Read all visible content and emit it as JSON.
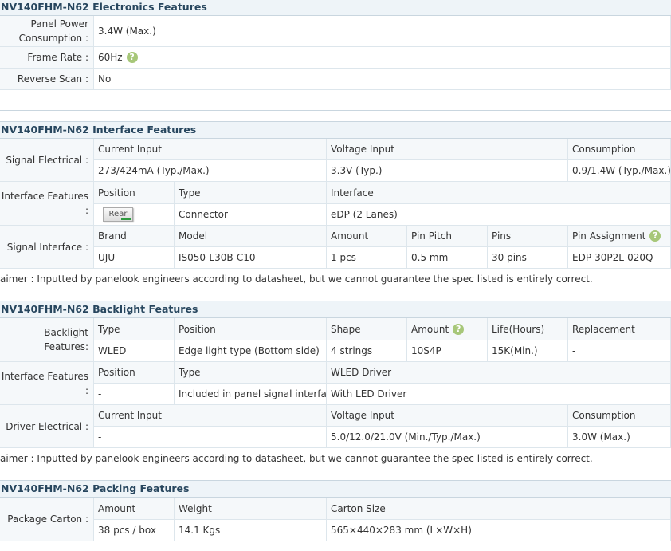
{
  "electronics": {
    "title": "NV140FHM-N62 Electronics Features",
    "rows": [
      {
        "label": "Panel Power Consumption :",
        "value": "3.4W (Max.)"
      },
      {
        "label": "Frame Rate :",
        "value": "60Hz"
      },
      {
        "label": "Reverse Scan :",
        "value": "No"
      }
    ]
  },
  "interface": {
    "title": "NV140FHM-N62 Interface Features",
    "signal_electrical": {
      "label": "Signal Electrical :",
      "headers": [
        "Current Input",
        "Voltage Input",
        "Consumption"
      ],
      "values": [
        "273/424mA (Typ./Max.)",
        "3.3V (Typ.)",
        "0.9/1.4W (Typ./Max.)"
      ]
    },
    "interface_features": {
      "label": "Interface Features :",
      "headers": [
        "Position",
        "Type",
        "Interface"
      ],
      "rear_button": "Rear",
      "values": [
        "Connector",
        "eDP (2 Lanes)"
      ]
    },
    "signal_interface": {
      "label": "Signal Interface :",
      "headers": [
        "Brand",
        "Model",
        "Amount",
        "Pin Pitch",
        "Pins",
        "Pin Assignment"
      ],
      "values": [
        "UJU",
        "IS050-L30B-C10",
        "1 pcs",
        "0.5 mm",
        "30 pins",
        "EDP-30P2L-020Q"
      ]
    },
    "disclaimer": "aimer : Inputted by panelook engineers according to datasheet, but we cannot guarantee the spec listed is entirely correct."
  },
  "backlight": {
    "title": "NV140FHM-N62 Backlight Features",
    "backlight_features": {
      "label": "Backlight Features:",
      "headers": [
        "Type",
        "Position",
        "Shape",
        "Amount",
        "Life(Hours)",
        "Replacement"
      ],
      "values": [
        "WLED",
        "Edge light type (Bottom side)",
        "4 strings",
        "10S4P",
        "15K(Min.)",
        "-"
      ]
    },
    "interface_features": {
      "label": "Interface Features :",
      "headers": [
        "Position",
        "Type",
        "WLED Driver"
      ],
      "values": [
        "-",
        "Included in panel signal interface",
        "With LED Driver"
      ]
    },
    "driver_electrical": {
      "label": "Driver Electrical :",
      "headers": [
        "Current Input",
        "Voltage Input",
        "Consumption"
      ],
      "values": [
        "-",
        "5.0/12.0/21.0V (Min./Typ./Max.)",
        "3.0W (Max.)"
      ]
    },
    "disclaimer": "aimer : Inputted by panelook engineers according to datasheet, but we cannot guarantee the spec listed is entirely correct."
  },
  "packing": {
    "title": "NV140FHM-N62 Packing Features",
    "package_carton": {
      "label": "Package Carton :",
      "headers": [
        "Amount",
        "Weight",
        "Carton Size"
      ],
      "values": [
        "38 pcs / box",
        "14.1 Kgs",
        "565×440×283 mm (L×W×H)"
      ]
    },
    "help_glyph": "?"
  }
}
